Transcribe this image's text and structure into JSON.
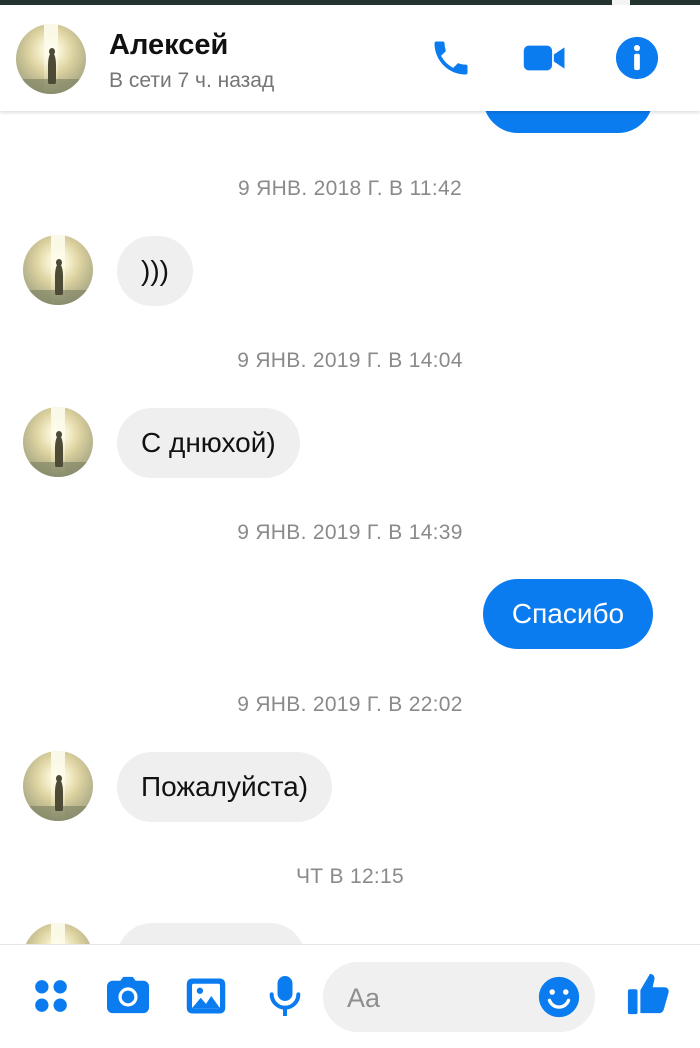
{
  "header": {
    "name": "Алексей",
    "status": "В сети 7 ч. назад"
  },
  "messages": [
    {
      "kind": "stamp",
      "text": "9 ЯНВ. 2018 Г. В 11:42"
    },
    {
      "kind": "in",
      "text": ")))"
    },
    {
      "kind": "stamp",
      "text": "9 ЯНВ. 2019 Г. В 14:04"
    },
    {
      "kind": "in",
      "text": "С днюхой)"
    },
    {
      "kind": "stamp",
      "text": "9 ЯНВ. 2019 Г. В 14:39"
    },
    {
      "kind": "out",
      "text": "Спасибо"
    },
    {
      "kind": "stamp",
      "text": "9 ЯНВ. 2019 Г. В 22:02"
    },
    {
      "kind": "in",
      "text": "Пожалуйста)"
    },
    {
      "kind": "stamp",
      "text": "ЧТ В 12:15"
    }
  ],
  "composer": {
    "placeholder": "Aa",
    "value": ""
  },
  "colors": {
    "accent": "#0a7cf0",
    "incoming_bubble": "#efefef",
    "timestamp": "#8a8a8a"
  },
  "icons": {
    "header": [
      "phone-icon",
      "video-camera-icon",
      "info-icon"
    ],
    "bottom": [
      "apps-grid-icon",
      "camera-icon",
      "gallery-icon",
      "microphone-icon",
      "emoji-icon",
      "thumbs-up-icon"
    ]
  }
}
